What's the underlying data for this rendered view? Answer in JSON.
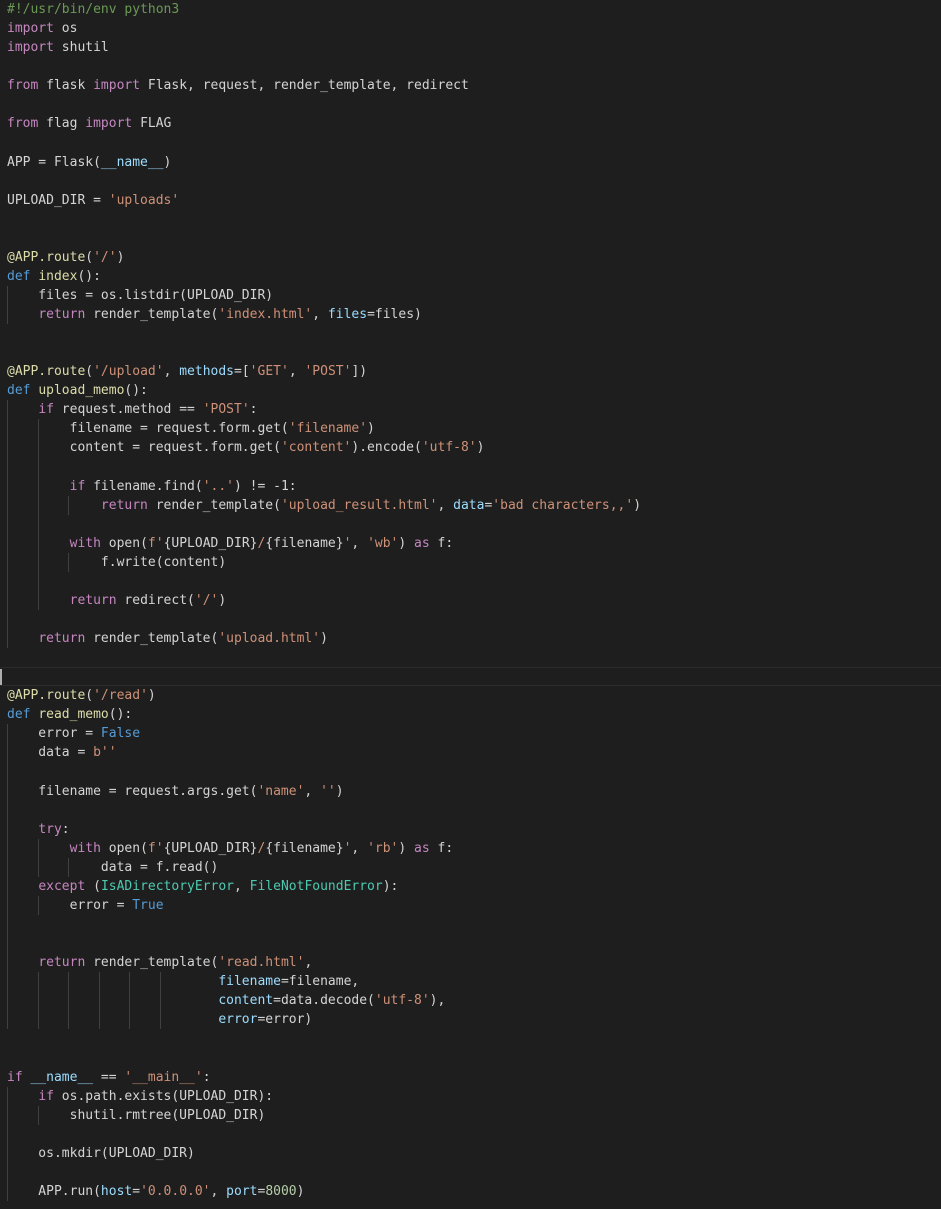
{
  "editor": {
    "language": "python",
    "cursor_line": 36,
    "colors": {
      "background": "#1e1e1e",
      "keyword": "#c586c0",
      "def_keyword": "#569cd6",
      "function": "#dcdcaa",
      "string": "#ce9178",
      "comment": "#6a9955",
      "parameter": "#9cdcfe",
      "type": "#4ec9b0",
      "number": "#b5cea8",
      "text": "#d4d4d4"
    },
    "lines": [
      {
        "guides": 0,
        "tokens": [
          [
            "cm",
            "#!/usr/bin/env python3"
          ]
        ]
      },
      {
        "guides": 0,
        "tokens": [
          [
            "kw",
            "import"
          ],
          [
            "pl",
            " os"
          ]
        ]
      },
      {
        "guides": 0,
        "tokens": [
          [
            "kw",
            "import"
          ],
          [
            "pl",
            " shutil"
          ]
        ]
      },
      {
        "guides": 0,
        "tokens": []
      },
      {
        "guides": 0,
        "tokens": [
          [
            "kw",
            "from"
          ],
          [
            "pl",
            " flask "
          ],
          [
            "kw",
            "import"
          ],
          [
            "pl",
            " Flask, request, render_template, redirect"
          ]
        ]
      },
      {
        "guides": 0,
        "tokens": []
      },
      {
        "guides": 0,
        "tokens": [
          [
            "kw",
            "from"
          ],
          [
            "pl",
            " flag "
          ],
          [
            "kw",
            "import"
          ],
          [
            "pl",
            " FLAG"
          ]
        ]
      },
      {
        "guides": 0,
        "tokens": []
      },
      {
        "guides": 0,
        "tokens": [
          [
            "pl",
            "APP = Flask("
          ],
          [
            "prm",
            "__name__"
          ],
          [
            "pl",
            ")"
          ]
        ]
      },
      {
        "guides": 0,
        "tokens": []
      },
      {
        "guides": 0,
        "tokens": [
          [
            "pl",
            "UPLOAD_DIR = "
          ],
          [
            "str",
            "'uploads'"
          ]
        ]
      },
      {
        "guides": 0,
        "tokens": []
      },
      {
        "guides": 0,
        "tokens": []
      },
      {
        "guides": 0,
        "tokens": [
          [
            "fn",
            "@APP.route"
          ],
          [
            "pl",
            "("
          ],
          [
            "str",
            "'/'"
          ],
          [
            "pl",
            ")"
          ]
        ]
      },
      {
        "guides": 0,
        "tokens": [
          [
            "dkw",
            "def"
          ],
          [
            "pl",
            " "
          ],
          [
            "fn",
            "index"
          ],
          [
            "pl",
            "():"
          ]
        ]
      },
      {
        "guides": 1,
        "tokens": [
          [
            "pl",
            "    files = os.listdir(UPLOAD_DIR)"
          ]
        ]
      },
      {
        "guides": 1,
        "tokens": [
          [
            "pl",
            "    "
          ],
          [
            "kw",
            "return"
          ],
          [
            "pl",
            " render_template("
          ],
          [
            "str",
            "'index.html'"
          ],
          [
            "pl",
            ", "
          ],
          [
            "prm",
            "files"
          ],
          [
            "pl",
            "=files)"
          ]
        ]
      },
      {
        "guides": 0,
        "tokens": []
      },
      {
        "guides": 0,
        "tokens": []
      },
      {
        "guides": 0,
        "tokens": [
          [
            "fn",
            "@APP.route"
          ],
          [
            "pl",
            "("
          ],
          [
            "str",
            "'/upload'"
          ],
          [
            "pl",
            ", "
          ],
          [
            "prm",
            "methods"
          ],
          [
            "pl",
            "=["
          ],
          [
            "str",
            "'GET'"
          ],
          [
            "pl",
            ", "
          ],
          [
            "str",
            "'POST'"
          ],
          [
            "pl",
            "])"
          ]
        ]
      },
      {
        "guides": 0,
        "tokens": [
          [
            "dkw",
            "def"
          ],
          [
            "pl",
            " "
          ],
          [
            "fn",
            "upload_memo"
          ],
          [
            "pl",
            "():"
          ]
        ]
      },
      {
        "guides": 1,
        "tokens": [
          [
            "pl",
            "    "
          ],
          [
            "kw",
            "if"
          ],
          [
            "pl",
            " request.method == "
          ],
          [
            "str",
            "'POST'"
          ],
          [
            "pl",
            ":"
          ]
        ]
      },
      {
        "guides": 2,
        "tokens": [
          [
            "pl",
            "        filename = request.form.get("
          ],
          [
            "str",
            "'filename'"
          ],
          [
            "pl",
            ")"
          ]
        ]
      },
      {
        "guides": 2,
        "tokens": [
          [
            "pl",
            "        content = request.form.get("
          ],
          [
            "str",
            "'content'"
          ],
          [
            "pl",
            ").encode("
          ],
          [
            "str",
            "'utf-8'"
          ],
          [
            "pl",
            ")"
          ]
        ]
      },
      {
        "guides": 2,
        "tokens": []
      },
      {
        "guides": 2,
        "tokens": [
          [
            "pl",
            "        "
          ],
          [
            "kw",
            "if"
          ],
          [
            "pl",
            " filename.find("
          ],
          [
            "str",
            "'..'"
          ],
          [
            "pl",
            ") != -1:"
          ]
        ]
      },
      {
        "guides": 3,
        "tokens": [
          [
            "pl",
            "            "
          ],
          [
            "kw",
            "return"
          ],
          [
            "pl",
            " render_template("
          ],
          [
            "str",
            "'upload_result.html'"
          ],
          [
            "pl",
            ", "
          ],
          [
            "prm",
            "data"
          ],
          [
            "pl",
            "="
          ],
          [
            "str",
            "'bad characters,,'"
          ],
          [
            "pl",
            ")"
          ]
        ]
      },
      {
        "guides": 2,
        "tokens": []
      },
      {
        "guides": 2,
        "tokens": [
          [
            "pl",
            "        "
          ],
          [
            "kw",
            "with"
          ],
          [
            "pl",
            " open("
          ],
          [
            "str",
            "f'"
          ],
          [
            "pl",
            "{UPLOAD_DIR}"
          ],
          [
            "str",
            "/"
          ],
          [
            "pl",
            "{filename}"
          ],
          [
            "str",
            "'"
          ],
          [
            "pl",
            ", "
          ],
          [
            "str",
            "'wb'"
          ],
          [
            "pl",
            ") "
          ],
          [
            "kw",
            "as"
          ],
          [
            "pl",
            " f:"
          ]
        ]
      },
      {
        "guides": 3,
        "tokens": [
          [
            "pl",
            "            f.write(content)"
          ]
        ]
      },
      {
        "guides": 2,
        "tokens": []
      },
      {
        "guides": 2,
        "tokens": [
          [
            "pl",
            "        "
          ],
          [
            "kw",
            "return"
          ],
          [
            "pl",
            " redirect("
          ],
          [
            "str",
            "'/'"
          ],
          [
            "pl",
            ")"
          ]
        ]
      },
      {
        "guides": 1,
        "tokens": []
      },
      {
        "guides": 1,
        "tokens": [
          [
            "pl",
            "    "
          ],
          [
            "kw",
            "return"
          ],
          [
            "pl",
            " render_template("
          ],
          [
            "str",
            "'upload.html'"
          ],
          [
            "pl",
            ")"
          ]
        ]
      },
      {
        "guides": 0,
        "tokens": []
      },
      {
        "guides": 0,
        "tokens": []
      },
      {
        "guides": 0,
        "tokens": [
          [
            "fn",
            "@APP.route"
          ],
          [
            "pl",
            "("
          ],
          [
            "str",
            "'/read'"
          ],
          [
            "pl",
            ")"
          ]
        ]
      },
      {
        "guides": 0,
        "tokens": [
          [
            "dkw",
            "def"
          ],
          [
            "pl",
            " "
          ],
          [
            "fn",
            "read_memo"
          ],
          [
            "pl",
            "():"
          ]
        ]
      },
      {
        "guides": 1,
        "tokens": [
          [
            "pl",
            "    error = "
          ],
          [
            "const",
            "False"
          ]
        ]
      },
      {
        "guides": 1,
        "tokens": [
          [
            "pl",
            "    data = "
          ],
          [
            "str",
            "b''"
          ]
        ]
      },
      {
        "guides": 1,
        "tokens": []
      },
      {
        "guides": 1,
        "tokens": [
          [
            "pl",
            "    filename = request.args.get("
          ],
          [
            "str",
            "'name'"
          ],
          [
            "pl",
            ", "
          ],
          [
            "str",
            "''"
          ],
          [
            "pl",
            ")"
          ]
        ]
      },
      {
        "guides": 1,
        "tokens": []
      },
      {
        "guides": 1,
        "tokens": [
          [
            "pl",
            "    "
          ],
          [
            "kw",
            "try"
          ],
          [
            "pl",
            ":"
          ]
        ]
      },
      {
        "guides": 2,
        "tokens": [
          [
            "pl",
            "        "
          ],
          [
            "kw",
            "with"
          ],
          [
            "pl",
            " open("
          ],
          [
            "str",
            "f'"
          ],
          [
            "pl",
            "{UPLOAD_DIR}"
          ],
          [
            "str",
            "/"
          ],
          [
            "pl",
            "{filename}"
          ],
          [
            "str",
            "'"
          ],
          [
            "pl",
            ", "
          ],
          [
            "str",
            "'rb'"
          ],
          [
            "pl",
            ") "
          ],
          [
            "kw",
            "as"
          ],
          [
            "pl",
            " f:"
          ]
        ]
      },
      {
        "guides": 3,
        "tokens": [
          [
            "pl",
            "            data = f.read()"
          ]
        ]
      },
      {
        "guides": 1,
        "tokens": [
          [
            "pl",
            "    "
          ],
          [
            "kw",
            "except"
          ],
          [
            "pl",
            " ("
          ],
          [
            "typ",
            "IsADirectoryError"
          ],
          [
            "pl",
            ", "
          ],
          [
            "typ",
            "FileNotFoundError"
          ],
          [
            "pl",
            "):"
          ]
        ]
      },
      {
        "guides": 2,
        "tokens": [
          [
            "pl",
            "        error = "
          ],
          [
            "const",
            "True"
          ]
        ]
      },
      {
        "guides": 1,
        "tokens": []
      },
      {
        "guides": 1,
        "tokens": []
      },
      {
        "guides": 1,
        "tokens": [
          [
            "pl",
            "    "
          ],
          [
            "kw",
            "return"
          ],
          [
            "pl",
            " render_template("
          ],
          [
            "str",
            "'read.html'"
          ],
          [
            "pl",
            ","
          ]
        ]
      },
      {
        "guides": 6,
        "tokens": [
          [
            "pl",
            "                           "
          ],
          [
            "prm",
            "filename"
          ],
          [
            "pl",
            "=filename,"
          ]
        ]
      },
      {
        "guides": 6,
        "tokens": [
          [
            "pl",
            "                           "
          ],
          [
            "prm",
            "content"
          ],
          [
            "pl",
            "=data.decode("
          ],
          [
            "str",
            "'utf-8'"
          ],
          [
            "pl",
            "),"
          ]
        ]
      },
      {
        "guides": 6,
        "tokens": [
          [
            "pl",
            "                           "
          ],
          [
            "prm",
            "error"
          ],
          [
            "pl",
            "=error)"
          ]
        ]
      },
      {
        "guides": 0,
        "tokens": []
      },
      {
        "guides": 0,
        "tokens": []
      },
      {
        "guides": 0,
        "tokens": [
          [
            "kw",
            "if"
          ],
          [
            "pl",
            " "
          ],
          [
            "prm",
            "__name__"
          ],
          [
            "pl",
            " == "
          ],
          [
            "str",
            "'__main__'"
          ],
          [
            "pl",
            ":"
          ]
        ]
      },
      {
        "guides": 1,
        "tokens": [
          [
            "pl",
            "    "
          ],
          [
            "kw",
            "if"
          ],
          [
            "pl",
            " os.path.exists(UPLOAD_DIR):"
          ]
        ]
      },
      {
        "guides": 2,
        "tokens": [
          [
            "pl",
            "        shutil.rmtree(UPLOAD_DIR)"
          ]
        ]
      },
      {
        "guides": 1,
        "tokens": []
      },
      {
        "guides": 1,
        "tokens": [
          [
            "pl",
            "    os.mkdir(UPLOAD_DIR)"
          ]
        ]
      },
      {
        "guides": 1,
        "tokens": []
      },
      {
        "guides": 1,
        "tokens": [
          [
            "pl",
            "    APP.run("
          ],
          [
            "prm",
            "host"
          ],
          [
            "pl",
            "="
          ],
          [
            "str",
            "'0.0.0.0'"
          ],
          [
            "pl",
            ", "
          ],
          [
            "prm",
            "port"
          ],
          [
            "pl",
            "="
          ],
          [
            "num",
            "8000"
          ],
          [
            "pl",
            ")"
          ]
        ]
      }
    ]
  }
}
